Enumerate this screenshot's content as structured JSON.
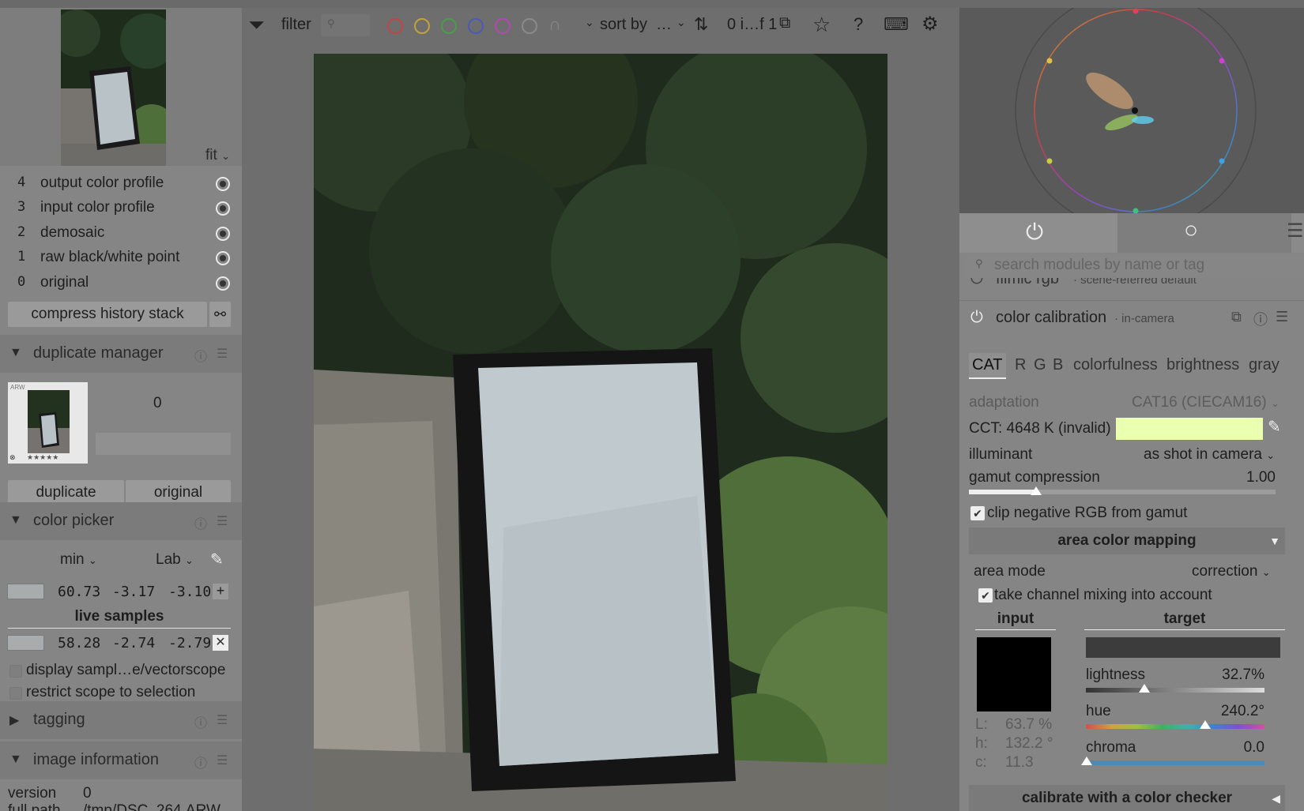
{
  "left": {
    "fit_label": "fit",
    "history": [
      {
        "n": "4",
        "label": "output color profile"
      },
      {
        "n": "3",
        "label": "input color profile"
      },
      {
        "n": "2",
        "label": "demosaic"
      },
      {
        "n": "1",
        "label": "raw black/white point"
      },
      {
        "n": "0",
        "label": "original"
      }
    ],
    "compress_button": "compress history stack",
    "duplicate_manager": {
      "title": "duplicate manager",
      "thumb_tag": "ARW",
      "count": "0",
      "duplicate_button": "duplicate",
      "original_button": "original"
    },
    "color_picker": {
      "title": "color picker",
      "mode": "min",
      "space": "Lab",
      "values": [
        "60.73",
        "-3.17",
        "-3.10"
      ],
      "live_samples_label": "live samples",
      "sample_values": [
        "58.28",
        "-2.74",
        "-2.79"
      ],
      "display_samples_label": "display sampl…e/vectorscope",
      "restrict_scope_label": "restrict scope to selection"
    },
    "tagging_title": "tagging",
    "image_information_title": "image information",
    "version_label": "version",
    "version_value": "0",
    "full_path_label": "full path",
    "full_path_value": "/tmp/DSC_264.ARW"
  },
  "topbar": {
    "filter_label": "filter",
    "sort_label": "sort by",
    "sort_value": "…",
    "count_text": "0 i…f 1",
    "color_labels": [
      "#c04545",
      "#c4a23a",
      "#4a9e4a",
      "#4a5ab8",
      "#b04ab0"
    ]
  },
  "right": {
    "search_placeholder": "search modules by name or tag",
    "filmic_title": "filmic rgb",
    "filmic_sub": "· scene-referred default",
    "cc_title": "color calibration",
    "cc_sub": "· in-camera",
    "tabs": [
      "CAT",
      "R",
      "G",
      "B",
      "colorfulness",
      "brightness",
      "gray"
    ],
    "adaptation_label": "adaptation",
    "adaptation_value": "CAT16 (CIECAM16)",
    "cct_text": "CCT: 4648 K (invalid)",
    "cct_color": "#eaffb0",
    "illuminant_label": "illuminant",
    "illuminant_value": "as shot in camera",
    "gamut_label": "gamut compression",
    "gamut_value": "1.00",
    "gamut_fraction": 0.22,
    "clip_label": "clip negative RGB from gamut",
    "area_title": "area color mapping",
    "area_mode_label": "area mode",
    "area_mode_value": "correction",
    "take_channel_label": "take channel mixing into account",
    "input_label": "input",
    "target_label": "target",
    "L_label": "L:",
    "L_value": "63.7 %",
    "h_label": "h:",
    "h_value": "132.2 °",
    "c_label": "c:",
    "c_value": "11.3",
    "lightness_label": "lightness",
    "lightness_value": "32.7%",
    "lightness_fraction": 0.327,
    "hue_label": "hue",
    "hue_value": "240.2°",
    "hue_fraction": 0.667,
    "chroma_label": "chroma",
    "chroma_value": "0.0",
    "calibrate_label": "calibrate with a color checker"
  }
}
